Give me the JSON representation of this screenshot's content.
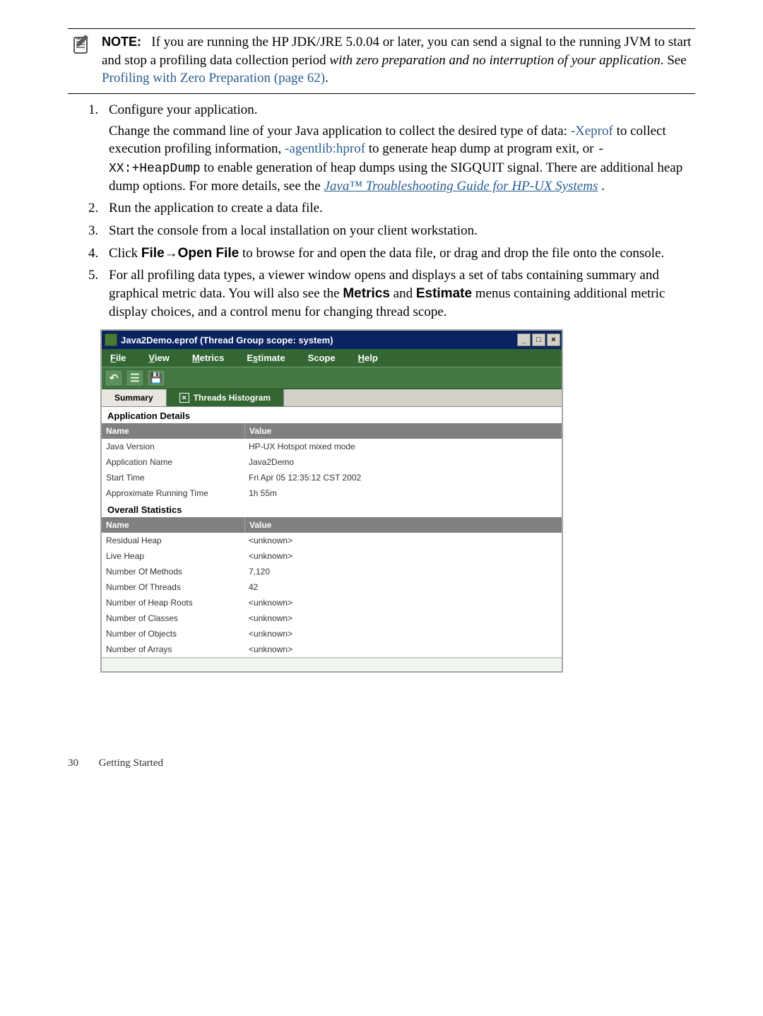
{
  "note": {
    "label": "NOTE:",
    "text_before_italic": "If you are running the HP JDK/JRE 5.0.04 or later, you can send a signal to the running JVM to start and stop a profiling data collection period",
    "italic_text": "with zero preparation and no interruption of your application",
    "after_italic": ". See ",
    "link_text": "Profiling with Zero Preparation (page 62)",
    "after_link": "."
  },
  "steps": {
    "s1": {
      "first": "Configure your application.",
      "para_a": "Change the command line of your Java application to collect the desired type of data: ",
      "link1": "-Xeprof",
      "para_b": " to collect execution profiling information, ",
      "link2": "-agentlib:hprof",
      "para_c": " to generate heap dump at program exit, or ",
      "code1": "-XX:+HeapDump",
      "para_d": " to enable generation of heap dumps using the SIGQUIT signal. There are additional heap dump options. For more details, see the  ",
      "link3": "Java™ Troubleshooting Guide for HP-UX Systems",
      "para_e": " ."
    },
    "s2": "Run the application to create a data file.",
    "s3": "Start the console from a local installation on your client workstation.",
    "s4": {
      "a": "Click ",
      "b": "File",
      "arrow": "→",
      "c": "Open File",
      "d": " to browse for and open the data file, or drag and drop the file onto the console."
    },
    "s5": {
      "a": "For all profiling data types, a viewer window opens and displays a set of tabs containing summary and graphical metric data. You will also see the ",
      "b": "Metrics",
      "c": " and ",
      "d": "Estimate",
      "e": " menus containing additional metric display choices, and a control menu for changing thread scope."
    }
  },
  "viewer": {
    "title": "Java2Demo.eprof (Thread Group scope: system)",
    "menus": {
      "file": "ile",
      "file_m": "F",
      "view": "iew",
      "view_m": "V",
      "metrics": "etrics",
      "metrics_m": "M",
      "estimate": "timate",
      "estimate_m": "s",
      "estimate_pre": "E",
      "scope": "Scope",
      "help": "elp",
      "help_m": "H"
    },
    "tabs": {
      "summary": "Summary",
      "threads": "Threads Histogram"
    },
    "section1": "Application Details",
    "col_name": "Name",
    "col_value": "Value",
    "app_details": [
      {
        "name": "Java Version",
        "value": "HP-UX Hotspot mixed mode"
      },
      {
        "name": "Application Name",
        "value": "Java2Demo"
      },
      {
        "name": "Start Time",
        "value": "Fri Apr 05 12:35:12 CST 2002"
      },
      {
        "name": "Approximate Running Time",
        "value": "1h 55m"
      }
    ],
    "section2": "Overall Statistics",
    "stats": [
      {
        "name": "Residual Heap",
        "value": "<unknown>"
      },
      {
        "name": "Live Heap",
        "value": "<unknown>"
      },
      {
        "name": "Number Of Methods",
        "value": "7,120"
      },
      {
        "name": "Number Of Threads",
        "value": "42"
      },
      {
        "name": "Number of Heap Roots",
        "value": "<unknown>"
      },
      {
        "name": "Number of Classes",
        "value": "<unknown>"
      },
      {
        "name": "Number of Objects",
        "value": "<unknown>"
      },
      {
        "name": "Number of Arrays",
        "value": "<unknown>"
      }
    ]
  },
  "footer": {
    "page": "30",
    "section": "Getting Started"
  }
}
